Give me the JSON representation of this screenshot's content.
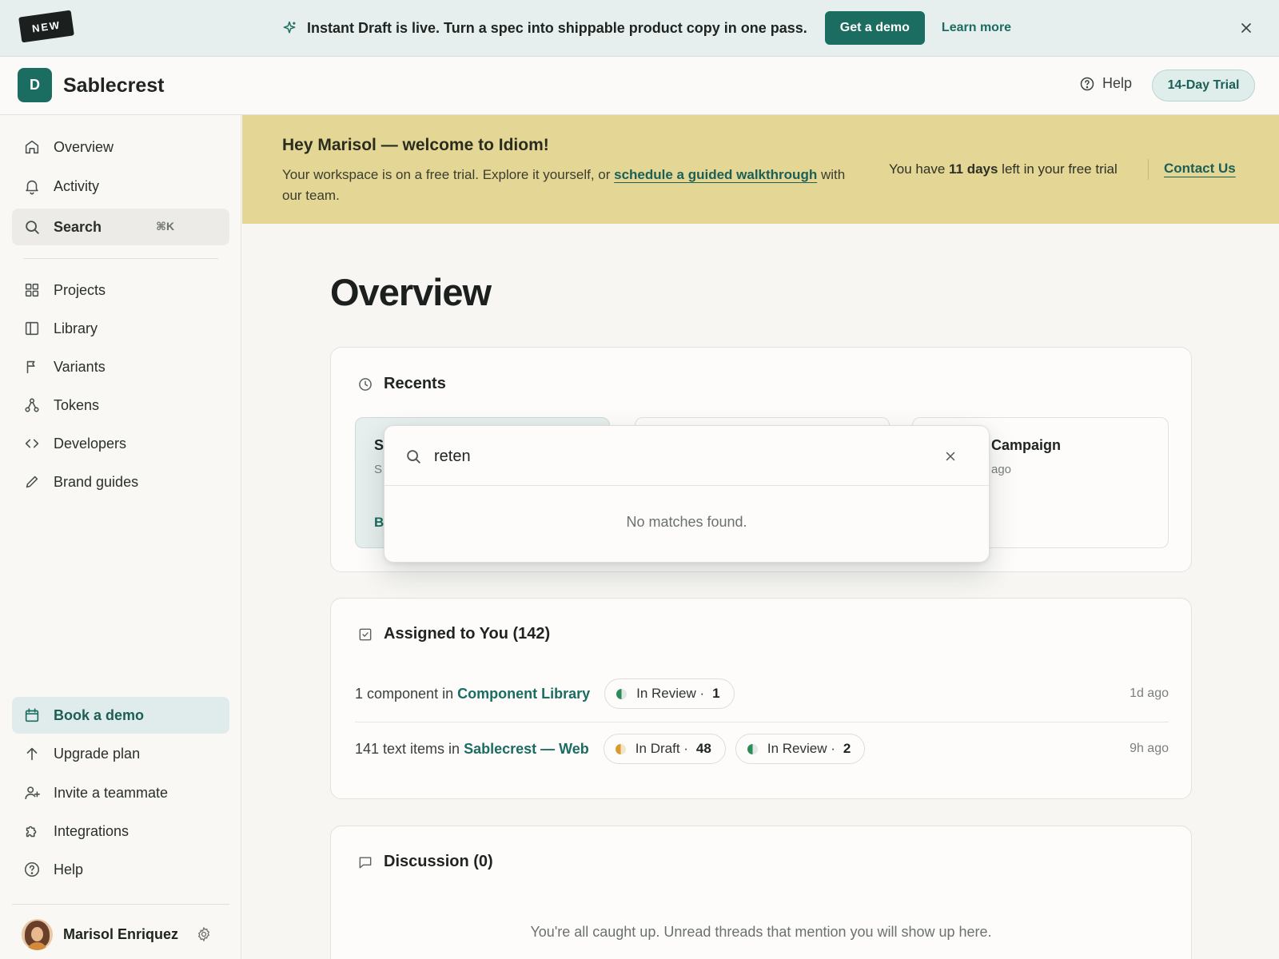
{
  "announcement": {
    "badge": "NEW",
    "text": "Instant Draft is live. Turn a spec into shippable product copy in one pass.",
    "demo_button": "Get a demo",
    "learn_more": "Learn more"
  },
  "header": {
    "logo_letter": "D",
    "brand": "Sablecrest",
    "help": "Help",
    "trial_badge": "14-Day Trial"
  },
  "sidebar": {
    "top_items": [
      {
        "label": "Overview",
        "icon": "home-icon"
      },
      {
        "label": "Activity",
        "icon": "bell-icon"
      },
      {
        "label": "Search",
        "icon": "search-icon",
        "shortcut": "⌘K"
      }
    ],
    "nav_items": [
      {
        "label": "Projects",
        "icon": "grid-icon"
      },
      {
        "label": "Library",
        "icon": "book-icon"
      },
      {
        "label": "Variants",
        "icon": "variant-icon"
      },
      {
        "label": "Tokens",
        "icon": "tokens-icon"
      },
      {
        "label": "Developers",
        "icon": "code-icon"
      },
      {
        "label": "Brand guides",
        "icon": "pencil-icon"
      }
    ],
    "bottom_items": [
      {
        "label": "Book a demo",
        "icon": "calendar-icon"
      },
      {
        "label": "Upgrade plan",
        "icon": "arrow-up-icon"
      },
      {
        "label": "Invite a teammate",
        "icon": "user-plus-icon"
      },
      {
        "label": "Integrations",
        "icon": "puzzle-icon"
      },
      {
        "label": "Help",
        "icon": "help-circle-icon"
      }
    ],
    "user": {
      "name": "Marisol Enriquez"
    }
  },
  "welcome": {
    "title": "Hey Marisol — welcome to Idiom!",
    "body_prefix": "Your workspace is on a free trial. Explore it yourself, or ",
    "body_link": "schedule a guided walkthrough",
    "body_suffix": " with our team.",
    "trial_prefix": "You have ",
    "trial_days": "11 days",
    "trial_suffix": " left in your free trial",
    "contact": "Contact Us"
  },
  "main": {
    "title": "Overview",
    "recents": {
      "title": "Recents",
      "tiles": [
        {
          "title": "S",
          "meta": "S",
          "link": "B"
        },
        {
          "title": "",
          "meta": "",
          "link": ""
        },
        {
          "title": "Campaign",
          "meta": "ago",
          "link": ""
        }
      ]
    },
    "search_popover": {
      "query": "reten",
      "empty_text": "No matches found."
    },
    "assigned": {
      "title": "Assigned to You (142)",
      "rows": [
        {
          "prefix": "1 component in",
          "link": "Component Library",
          "pills": [
            {
              "label": "In Review ·",
              "count": "1",
              "status": "review"
            }
          ],
          "ago": "1d ago"
        },
        {
          "prefix": "141 text items in",
          "link": "Sablecrest — Web",
          "pills": [
            {
              "label": "In Draft ·",
              "count": "48",
              "status": "draft"
            },
            {
              "label": "In Review ·",
              "count": "2",
              "status": "review"
            }
          ],
          "ago": "9h ago"
        }
      ]
    },
    "discussion": {
      "title": "Discussion (0)",
      "empty_text": "You're all caught up. Unread threads that mention you will show up here."
    }
  },
  "colors": {
    "accent": "#1b6c61",
    "banner": "#e4d694",
    "announce_bg": "#e6efee",
    "review_dot": "#2f8a5a",
    "draft_dot": "#d89a2a"
  }
}
